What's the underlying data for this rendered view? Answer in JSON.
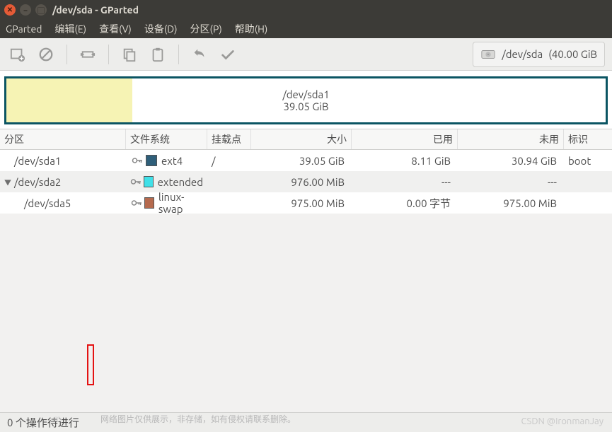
{
  "window": {
    "title": "/dev/sda - GParted"
  },
  "menu": {
    "gparted": "GParted",
    "edit": "编辑(E)",
    "view": "查看(V)",
    "device": "设备(D)",
    "partition": "分区(P)",
    "help": "帮助(H)"
  },
  "device_selector": {
    "device": "/dev/sda",
    "size": "(40.00 GiB"
  },
  "graph": {
    "partition": "/dev/sda1",
    "size": "39.05 GiB"
  },
  "columns": {
    "partition": "分区",
    "filesystem": "文件系统",
    "mountpoint": "挂载点",
    "size": "大小",
    "used": "已用",
    "unused": "未用",
    "flags": "标识"
  },
  "rows": [
    {
      "indent": 0,
      "expander": "",
      "name": "/dev/sda1",
      "locked": true,
      "fs_color": "sw-ext4",
      "filesystem": "ext4",
      "mountpoint": "/",
      "size": "39.05 GiB",
      "used": "8.11 GiB",
      "unused": "30.94 GiB",
      "flags": "boot"
    },
    {
      "indent": 0,
      "expander": "▼",
      "name": "/dev/sda2",
      "locked": true,
      "fs_color": "sw-extended",
      "filesystem": "extended",
      "mountpoint": "",
      "size": "976.00 MiB",
      "used": "---",
      "unused": "---",
      "flags": ""
    },
    {
      "indent": 1,
      "expander": "",
      "name": "/dev/sda5",
      "locked": true,
      "fs_color": "sw-swap",
      "filesystem": "linux-swap",
      "mountpoint": "",
      "size": "975.00 MiB",
      "used": "0.00 字节",
      "unused": "975.00 MiB",
      "flags": ""
    }
  ],
  "status": {
    "pending": "0 个操作待进行"
  },
  "watermark": {
    "author": "CSDN @IronmanJay",
    "note": "网络图片仅供展示，非存储，如有侵权请联系删除。",
    "url": "m"
  }
}
